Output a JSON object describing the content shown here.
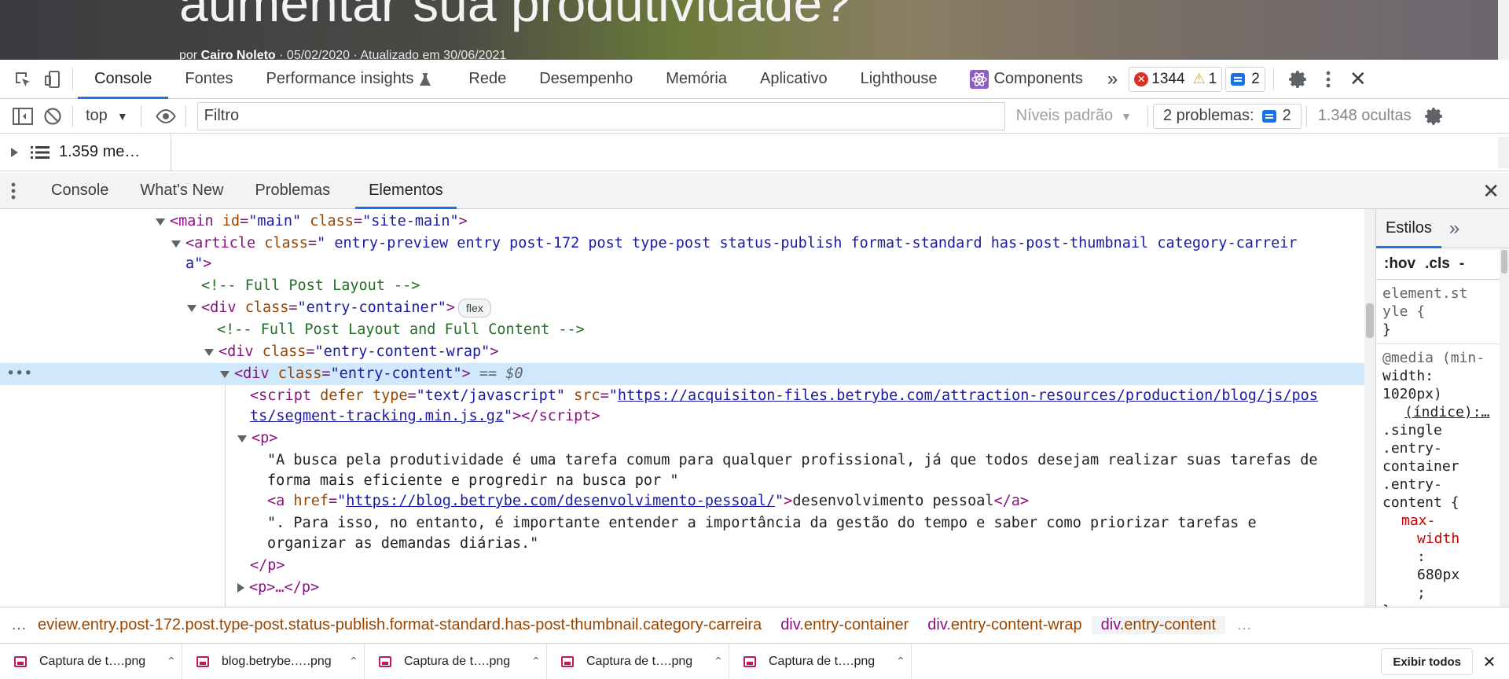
{
  "page": {
    "headline": "aumentar sua produtividade?",
    "byline_prefix": "por",
    "author": "Cairo Noleto",
    "byline_dates": "·  05/02/2020 · Atualizado em 30/06/2021"
  },
  "toolbar": {
    "tabs": [
      "Console",
      "Fontes",
      "Performance insights",
      "Rede",
      "Desempenho",
      "Memória",
      "Aplicativo",
      "Lighthouse",
      "Components"
    ],
    "active_tab": "Console",
    "more": "»",
    "errors": "1344",
    "warnings": "1",
    "issues": "2"
  },
  "filter_bar": {
    "context": "top",
    "filter_placeholder": "Filtro",
    "levels": "Níveis padrão",
    "problems_label": "2 problemas:",
    "problems_count": "2",
    "hidden": "1.348 ocultas"
  },
  "console": {
    "message_count": "1.359 me…"
  },
  "drawer": {
    "tabs": [
      "Console",
      "What's New",
      "Problemas",
      "Elementos"
    ],
    "active_tab": "Elementos"
  },
  "dom": {
    "main_tag": "<main",
    "main_id_attr": "id",
    "main_id_val": "\"main\"",
    "main_class_attr": "class",
    "main_class_val": "\"site-main\"",
    "article_open": "<article",
    "article_class_attr": "class",
    "article_class_val_1": "\" entry-preview entry post-172 post type-post status-publish format-standard has-post-thumbnail category-carreir",
    "article_class_val_2": "a\"",
    "comment_1": "<!-- Full Post Layout -->",
    "div_container_class": "\"entry-container\"",
    "flex_badge": "flex",
    "comment_2": "<!-- Full Post Layout and Full Content -->",
    "div_wrap_class": "\"entry-content-wrap\"",
    "div_content_class": "\"entry-content\"",
    "selected_marker": "== $0",
    "script_type_val": "\"text/javascript\"",
    "script_src_1": "https://acquisiton-files.betrybe.com/attraction-resources/production/blog/js/pos",
    "script_src_2": "ts/segment-tracking.min.js.gz",
    "p_text_1": "\"A busca pela produtividade é uma tarefa comum para qualquer profissional, já que todos desejam realizar suas tarefas de",
    "p_text_2": "forma mais eficiente e progredir na busca por \"",
    "a_href": "https://blog.betrybe.com/desenvolvimento-pessoal/",
    "a_text": "desenvolvimento pessoal",
    "p_text_3": "\". Para isso, no entanto, é importante entender a importância da gestão do tempo e saber como priorizar tarefas e",
    "p_text_4": "organizar as demandas diárias.\"",
    "p_close": "</p>",
    "p_collapsed": "<p>…</p>"
  },
  "styles": {
    "tab": "Estilos",
    "more": "»",
    "hov": ":hov",
    "cls": ".cls",
    "element_style_1": "element.st",
    "element_style_2": "yle {",
    "close_brace": "}",
    "media_1": "@media (min-",
    "media_2": "width:",
    "media_3": "1020px)",
    "media_index": "(índice):…",
    "selector_1": ".single",
    "selector_2": ".entry-",
    "selector_3": "container",
    "selector_4": ".entry-",
    "selector_5": "content {",
    "prop_1": "max-",
    "prop_2": "width",
    "colon": ":",
    "value": "680px",
    "semicolon": ";"
  },
  "breadcrumbs": {
    "first": "eview.entry.post-172.post.type-post.status-publish.format-standard.has-post-thumbnail.category-carreira",
    "items": [
      {
        "tag": "div",
        "cls": ".entry-container"
      },
      {
        "tag": "div",
        "cls": ".entry-content-wrap"
      },
      {
        "tag": "div",
        "cls": ".entry-content"
      }
    ],
    "more": "…"
  },
  "downloads": {
    "items": [
      "Captura de t….png",
      "blog.betrybe.….png",
      "Captura de t….png",
      "Captura de t….png",
      "Captura de t….png"
    ],
    "show_all": "Exibir todos"
  }
}
